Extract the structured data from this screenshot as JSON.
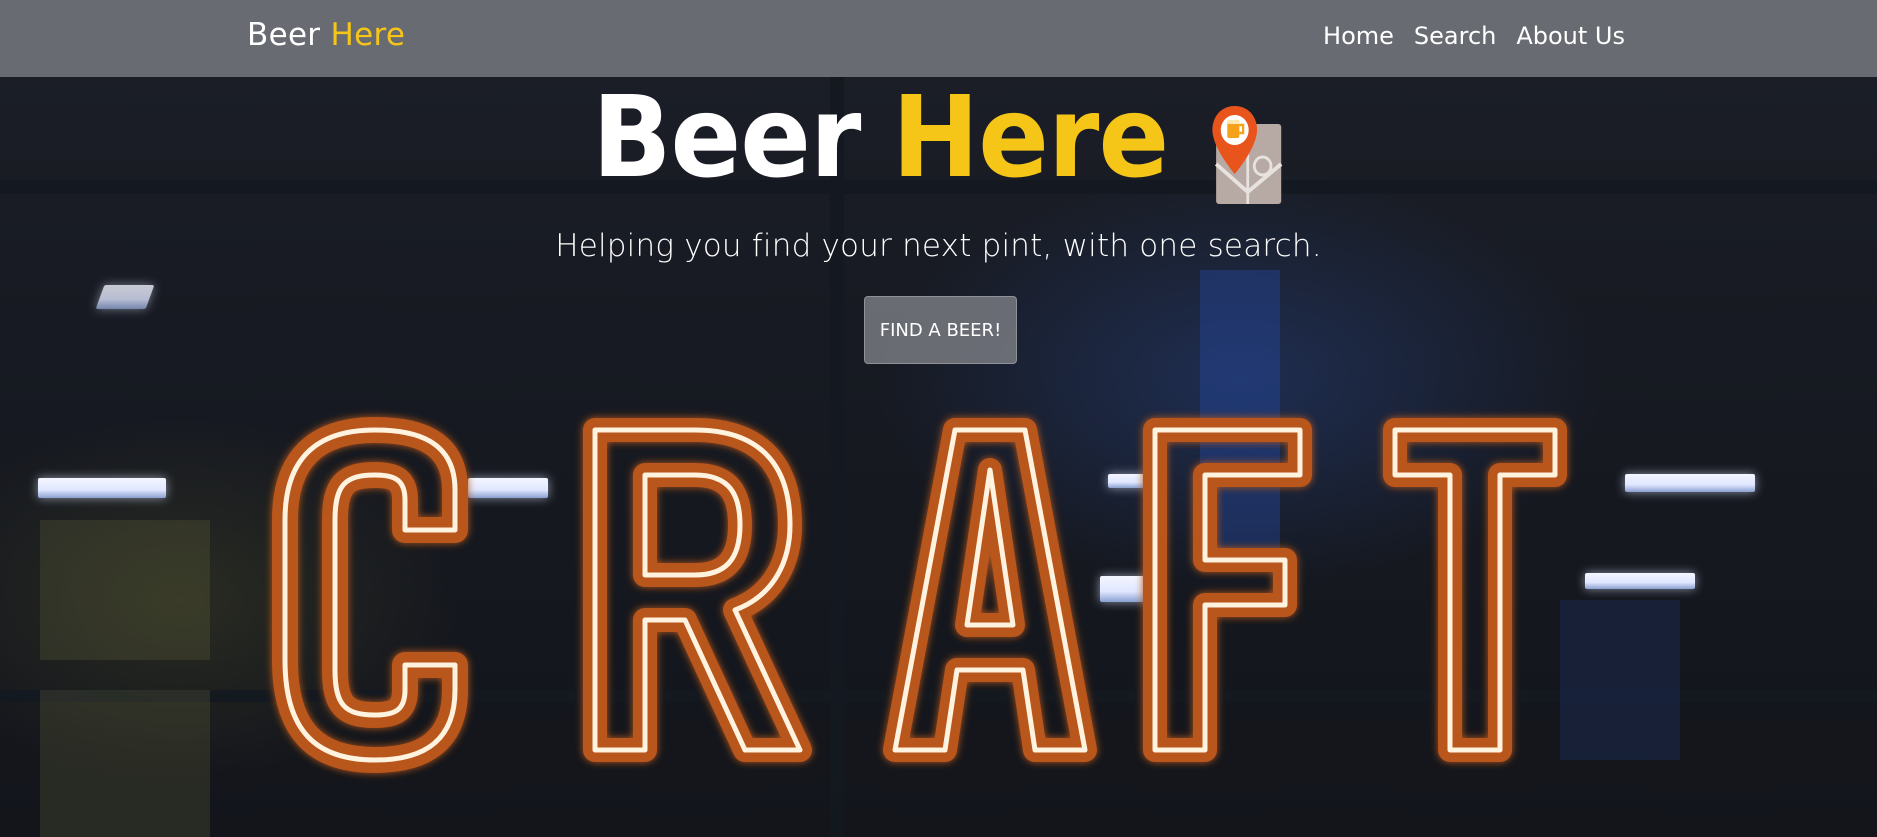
{
  "navbar": {
    "brand_part1": "Beer",
    "brand_part2": "Here",
    "links": [
      {
        "label": "Home"
      },
      {
        "label": "Search"
      },
      {
        "label": "About Us"
      }
    ]
  },
  "hero": {
    "title_part1": "Beer",
    "title_part2": "Here",
    "tagline": "Helping you find your next pint, with one search.",
    "cta_label": "FIND A BEER!",
    "logo_icon": "beer-map-pin-icon",
    "background_sign_text": "CRAFT"
  },
  "colors": {
    "accent": "#f5c518",
    "navbar_bg": "#707278",
    "neon_orange": "#e07a1c"
  }
}
